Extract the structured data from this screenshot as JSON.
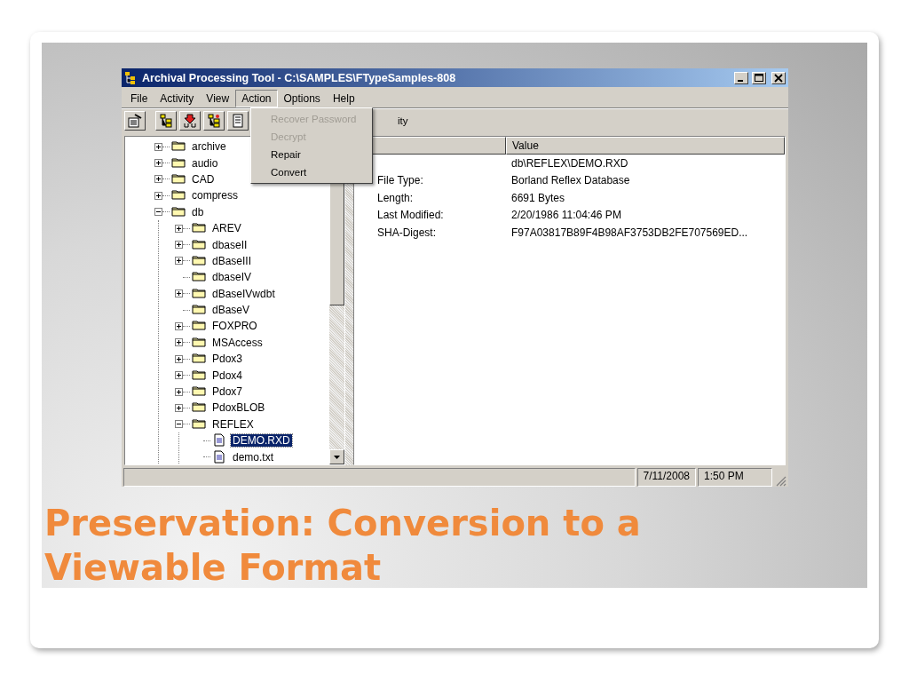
{
  "window": {
    "title": "Archival Processing Tool - C:\\SAMPLES\\FTypeSamples-808"
  },
  "menu_bar": [
    {
      "label": "File",
      "selected": false
    },
    {
      "label": "Activity",
      "selected": false
    },
    {
      "label": "View",
      "selected": false
    },
    {
      "label": "Action",
      "selected": true
    },
    {
      "label": "Options",
      "selected": false
    },
    {
      "label": "Help",
      "selected": false
    }
  ],
  "action_menu": [
    {
      "label": "Recover Password",
      "disabled": true
    },
    {
      "label": "Decrypt",
      "disabled": true
    },
    {
      "label": "Repair",
      "disabled": false
    },
    {
      "label": "Convert",
      "disabled": false
    }
  ],
  "toolbar": {
    "label": "ity"
  },
  "tree": [
    {
      "label": "archive",
      "kind": "folder",
      "expanded": false,
      "selected": false
    },
    {
      "label": "audio",
      "kind": "folder",
      "expanded": false,
      "selected": false
    },
    {
      "label": "CAD",
      "kind": "folder",
      "expanded": false,
      "selected": false
    },
    {
      "label": "compress",
      "kind": "folder",
      "expanded": false,
      "selected": false
    },
    {
      "label": "db",
      "kind": "folder",
      "expanded": true,
      "selected": false,
      "children": [
        {
          "label": "AREV",
          "kind": "folder",
          "expanded": false,
          "selected": false
        },
        {
          "label": "dbaseII",
          "kind": "folder",
          "expanded": false,
          "selected": false
        },
        {
          "label": "dBaseIII",
          "kind": "folder",
          "expanded": false,
          "selected": false
        },
        {
          "label": "dbaseIV",
          "kind": "folder",
          "selected": false
        },
        {
          "label": "dBaseIVwdbt",
          "kind": "folder",
          "expanded": false,
          "selected": false
        },
        {
          "label": "dBaseV",
          "kind": "folder",
          "selected": false
        },
        {
          "label": "FOXPRO",
          "kind": "folder",
          "expanded": false,
          "selected": false
        },
        {
          "label": "MSAccess",
          "kind": "folder",
          "expanded": false,
          "selected": false
        },
        {
          "label": "Pdox3",
          "kind": "folder",
          "expanded": false,
          "selected": false
        },
        {
          "label": "Pdox4",
          "kind": "folder",
          "expanded": false,
          "selected": false
        },
        {
          "label": "Pdox7",
          "kind": "folder",
          "expanded": false,
          "selected": false
        },
        {
          "label": "PdoxBLOB",
          "kind": "folder",
          "expanded": false,
          "selected": false
        },
        {
          "label": "REFLEX",
          "kind": "folder",
          "expanded": true,
          "selected": false,
          "children": [
            {
              "label": "DEMO.RXD",
              "kind": "file",
              "selected": true
            },
            {
              "label": "demo.txt",
              "kind": "file",
              "selected": false
            }
          ]
        }
      ]
    }
  ],
  "properties": {
    "value_header": "Value",
    "rows": [
      {
        "value": "db\\REFLEX\\DEMO.RXD"
      },
      {
        "property": "File Type:",
        "value": "Borland Reflex Database"
      },
      {
        "property": "Length:",
        "value": "6691 Bytes"
      },
      {
        "property": "Last Modified:",
        "value": "2/20/1986 11:04:46 PM"
      },
      {
        "property": "SHA-Digest:",
        "value": "F97A03817B89F4B98AF3753DB2FE707569ED..."
      }
    ]
  },
  "status_bar": {
    "date": "7/11/2008",
    "time": "1:50 PM"
  },
  "slide_title": "Preservation: Conversion to a Viewable Format"
}
